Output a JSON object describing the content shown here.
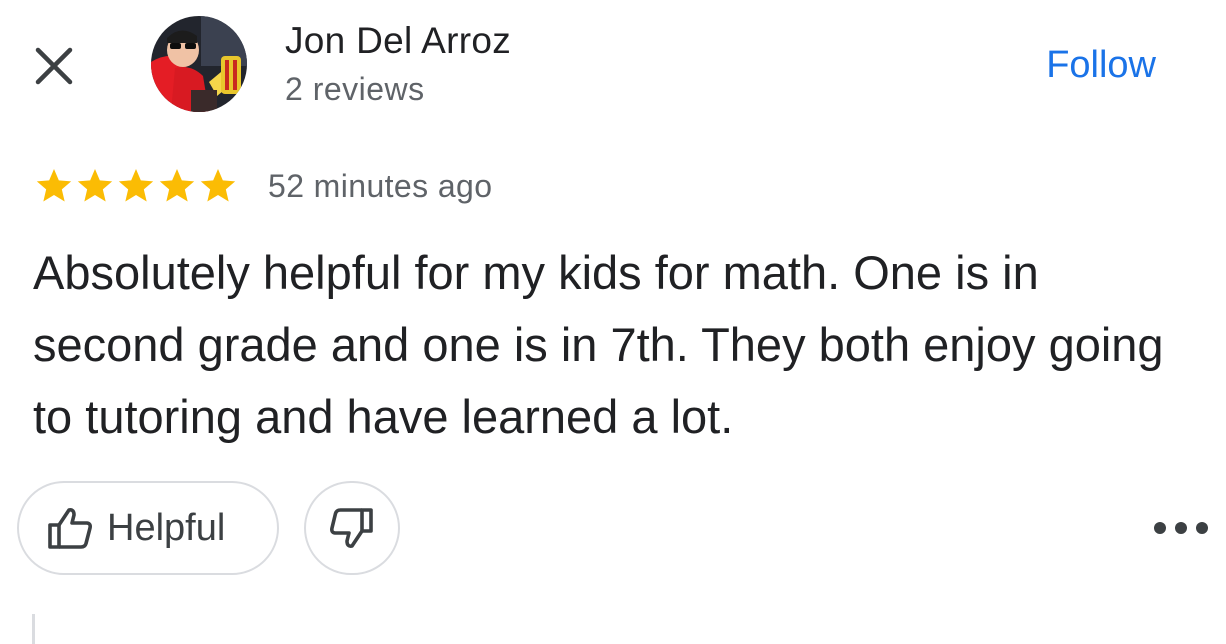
{
  "header": {
    "close_icon": "close-icon",
    "reviewer_name": "Jon Del Arroz",
    "reviewer_meta": "2 reviews",
    "follow_label": "Follow"
  },
  "review": {
    "rating": 5,
    "rating_max": 5,
    "timestamp": "52 minutes ago",
    "text": "Absolutely helpful for my kids for math. One is in second grade and one is in 7th. They both enjoy going to tutoring and have learned a lot."
  },
  "actions": {
    "helpful_label": "Helpful",
    "helpful_icon": "thumbs-up-icon",
    "dislike_icon": "thumbs-down-icon",
    "more_icon": "more-options-icon"
  },
  "colors": {
    "accent": "#1a73e8",
    "star": "#fbbc04",
    "text": "#202124",
    "secondary_text": "#5f6368",
    "border": "#dadce0"
  }
}
